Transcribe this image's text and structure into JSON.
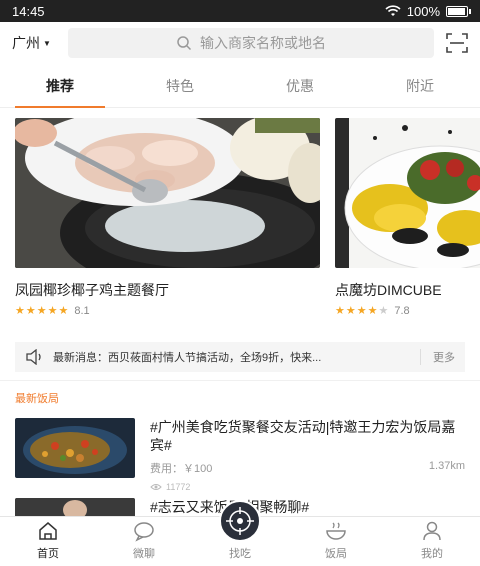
{
  "status_bar": {
    "time": "14:45",
    "battery": "100%",
    "battery_level": 1.0
  },
  "header": {
    "city": "广州",
    "search_placeholder": "输入商家名称或地名"
  },
  "tabs": [
    {
      "label": "推荐",
      "active": true
    },
    {
      "label": "特色",
      "active": false
    },
    {
      "label": "优惠",
      "active": false
    },
    {
      "label": "附近",
      "active": false
    }
  ],
  "featured": [
    {
      "name": "凤园椰珍椰子鸡主题餐厅",
      "rating": "8.1",
      "stars": 4.5
    },
    {
      "name": "点魔坊DIMCUBE",
      "rating": "7.8",
      "stars": 4
    }
  ],
  "news": {
    "text": "最新消息：西贝莜面村情人节搞活动，全场9折，快来...",
    "more": "更多"
  },
  "section": {
    "title": "最新饭局"
  },
  "events": [
    {
      "title": "#广州美食吃货聚餐交友活动|特邀王力宏为饭局嘉宾#",
      "fee": "费用：￥100",
      "distance": "1.37km",
      "views": "11772"
    },
    {
      "title": "#志云又来饭局|相聚畅聊#",
      "fee": "",
      "distance": "",
      "views": ""
    }
  ],
  "tabbar": [
    {
      "label": "首页",
      "icon": "home-icon",
      "active": true
    },
    {
      "label": "微聊",
      "icon": "chat-icon",
      "active": false
    },
    {
      "label": "找吃",
      "icon": "target-icon",
      "active": false
    },
    {
      "label": "饭局",
      "icon": "bowl-icon",
      "active": false
    },
    {
      "label": "我的",
      "icon": "person-icon",
      "active": false
    }
  ],
  "colors": {
    "accent": "#f07b2c",
    "star": "#f5a623",
    "status_bar": "#222222"
  }
}
